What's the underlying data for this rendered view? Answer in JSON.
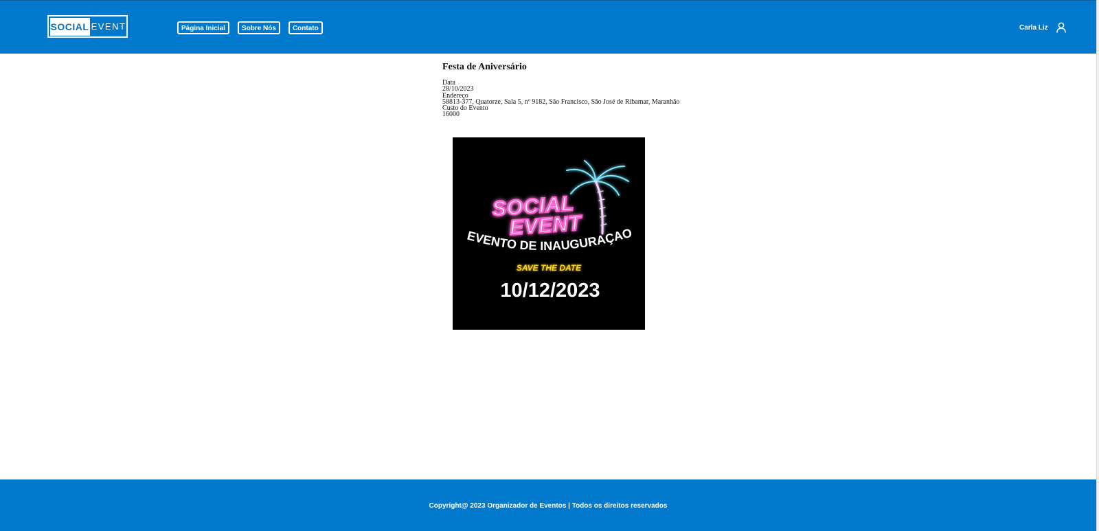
{
  "header": {
    "logo": {
      "left": "SOCIAL",
      "right": "EVENT"
    },
    "nav": [
      {
        "label": "Página Inicial"
      },
      {
        "label": "Sobre Nós"
      },
      {
        "label": "Contato"
      }
    ],
    "user": {
      "name": "Carla Liz",
      "icon": "user-icon"
    }
  },
  "event": {
    "title": "Festa de Aniversário",
    "fields": [
      {
        "label": "Data",
        "value": "28/10/2023"
      },
      {
        "label": "Endereço",
        "value": "58813-377, Quatorze, Sala 5, nº 9182, São Francisco, São José de Ribamar, Maranhão"
      },
      {
        "label": "Custo do Evento",
        "value": "16000"
      }
    ]
  },
  "poster": {
    "logo_top": "SOCIAL",
    "logo_bottom": "EVENT",
    "headline": "EVENTO DE INAUGURAÇAO",
    "tagline": "SAVE THE DATE",
    "date": "10/12/2023",
    "colors": {
      "pink": "#ff5fd2",
      "cyan": "#7de8ff",
      "yellow": "#ffd21e",
      "white": "#ffffff"
    }
  },
  "footer": {
    "text": "Copyright@ 2023 Organizador de Eventos | Todos os direitos reservados"
  },
  "theme": {
    "brand_blue": "#0079cc"
  }
}
